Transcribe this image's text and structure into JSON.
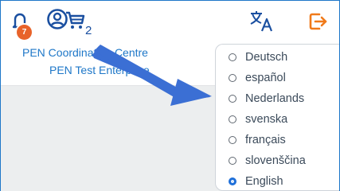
{
  "header": {
    "notifications": {
      "icon": "bell-icon",
      "badge_count": "7",
      "badge_color": "#e8632a"
    },
    "account": {
      "icon": "user-circle-icon"
    },
    "cart": {
      "icon": "cart-icon",
      "count": "2"
    },
    "language": {
      "icon": "translate-icon"
    },
    "logout": {
      "icon": "logout-icon",
      "color": "#f07a1a"
    }
  },
  "organization": {
    "line1": "PEN Coordination Centre",
    "line2": "PEN Test Enterprise"
  },
  "language_menu": {
    "options": [
      {
        "label": "Deutsch",
        "selected": false
      },
      {
        "label": "español",
        "selected": false
      },
      {
        "label": "Nederlands",
        "selected": false
      },
      {
        "label": "svenska",
        "selected": false
      },
      {
        "label": "français",
        "selected": false
      },
      {
        "label": "slovenščina",
        "selected": false
      },
      {
        "label": "English",
        "selected": true
      }
    ]
  },
  "colors": {
    "primary": "#1a4fa0",
    "link": "#1e77c8",
    "accent": "#e8632a",
    "arrow": "#3b6fd4"
  }
}
